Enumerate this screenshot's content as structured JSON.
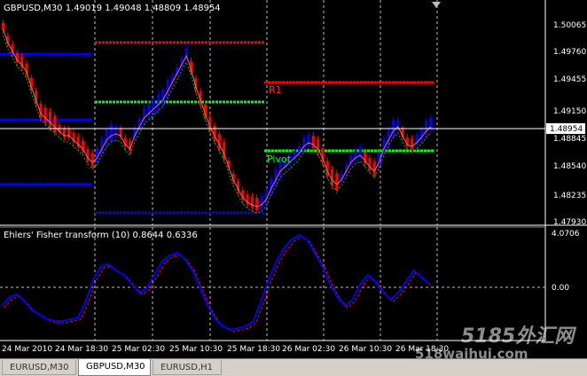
{
  "main_chart": {
    "header": "GBPUSD,M30  1.49019 1.49048 1.48809 1.48954",
    "price_axis": [
      "1.50065",
      "1.49760",
      "1.49455",
      "1.49150",
      "1.48845",
      "1.48540",
      "1.48235",
      "1.47930"
    ],
    "current_price": "1.48954",
    "level_labels": {
      "r1": "R1",
      "pivot": "Pivot"
    }
  },
  "indicator": {
    "header": "Ehlers' Fisher transform (10) 0.8644 0.6336",
    "axis": [
      "4.0706",
      "0.00"
    ]
  },
  "time_axis": [
    "24 Mar 2010",
    "24 Mar 18:30",
    "25 Mar 02:30",
    "25 Mar 10:30",
    "25 Mar 18:30",
    "26 Mar 02:30",
    "26 Mar 10:30",
    "26 Mar 18:30"
  ],
  "watermark": {
    "cn": "5185外汇网",
    "url": "518waihui.com"
  },
  "tabs": [
    {
      "label": "EURUSD,M30",
      "active": false
    },
    {
      "label": "GBPUSD,M30",
      "active": true
    },
    {
      "label": "EURUSD,H1",
      "active": false
    }
  ],
  "colors": {
    "background": "#000000",
    "bull": "#0000ff",
    "bear": "#ff0000",
    "pivot": "#00ff00",
    "resistance": "#ff0000",
    "support": "#0000ff",
    "fisher": "#0000ff",
    "trigger": "#ff0000",
    "text": "#ffffff"
  }
}
